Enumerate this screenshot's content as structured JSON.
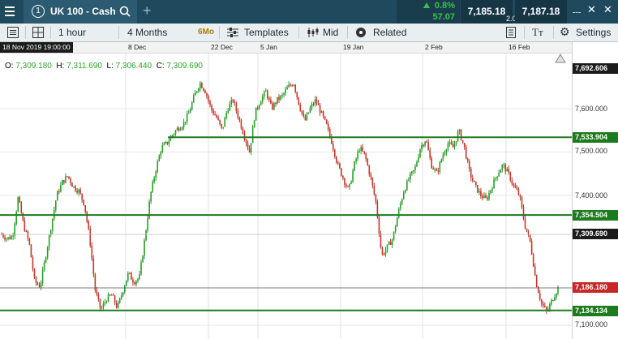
{
  "header": {
    "menu_icon": "hamburger-menu-icon",
    "instrument_number": "1",
    "instrument_name": "UK 100 - Cash",
    "change_percent": "0.8%",
    "change_points": "57.07",
    "sell_price": "7,185.18",
    "buy_price": "7,187.18",
    "spread": "2.00"
  },
  "toolbar": {
    "interval": "1 hour",
    "range": "4 Months",
    "range_badge": "6Mo",
    "templates": "Templates",
    "price_type": "Mid",
    "related": "Related",
    "settings": "Settings"
  },
  "time_axis": {
    "cursor_time": "18 Nov 2019 19:00:00",
    "labels": [
      "8 Dec",
      "22 Dec",
      "5 Jan",
      "19 Jan",
      "2 Feb",
      "16 Feb"
    ]
  },
  "ohlc": {
    "o_label": "O:",
    "o": "7,309.180",
    "h_label": "H:",
    "h": "7,311.690",
    "l_label": "L:",
    "l": "7,306.440",
    "c_label": "C:",
    "c": "7,309.690"
  },
  "price_axis": {
    "top_value": "7,692.606",
    "ticks": [
      "7,600.000",
      "7,500.000",
      "7,400.000",
      "7,100.000"
    ],
    "crosshair_value": "7,309.690",
    "current_price": "7,186.180",
    "levels": [
      "7,533.904",
      "7,354.504",
      "7,134.134"
    ]
  },
  "colors": {
    "up": "#2a9d2a",
    "down": "#c0392b",
    "level": "#1e7a1e",
    "header_bg": "#1f4a5e",
    "price_tag": "#c62828"
  },
  "chart_data": {
    "type": "candlestick",
    "interval": "1 hour",
    "ylim": [
      7090,
      7700
    ],
    "y_ticks": [
      7100,
      7400,
      7500,
      7600
    ],
    "horizontal_levels": [
      7533.904,
      7354.504,
      7134.134
    ],
    "crosshair_price": 7309.69,
    "current_price": 7186.18,
    "x_tick_labels": [
      "8 Dec",
      "22 Dec",
      "5 Jan",
      "19 Jan",
      "2 Feb",
      "16 Feb"
    ],
    "close_path": [
      7310,
      7300,
      7305,
      7395,
      7330,
      7290,
      7200,
      7190,
      7260,
      7330,
      7400,
      7430,
      7445,
      7420,
      7410,
      7380,
      7300,
      7180,
      7135,
      7160,
      7170,
      7140,
      7180,
      7220,
      7200,
      7210,
      7300,
      7400,
      7460,
      7510,
      7520,
      7540,
      7555,
      7565,
      7590,
      7630,
      7660,
      7640,
      7600,
      7580,
      7550,
      7600,
      7620,
      7580,
      7540,
      7500,
      7590,
      7620,
      7640,
      7600,
      7620,
      7630,
      7650,
      7660,
      7610,
      7570,
      7600,
      7620,
      7590,
      7560,
      7520,
      7470,
      7440,
      7410,
      7470,
      7510,
      7490,
      7440,
      7380,
      7260,
      7280,
      7300,
      7360,
      7410,
      7440,
      7460,
      7510,
      7530,
      7470,
      7450,
      7490,
      7520,
      7510,
      7550,
      7510,
      7450,
      7420,
      7400,
      7390,
      7420,
      7450,
      7470,
      7450,
      7420,
      7400,
      7330,
      7290,
      7200,
      7150,
      7130,
      7160,
      7186
    ]
  }
}
